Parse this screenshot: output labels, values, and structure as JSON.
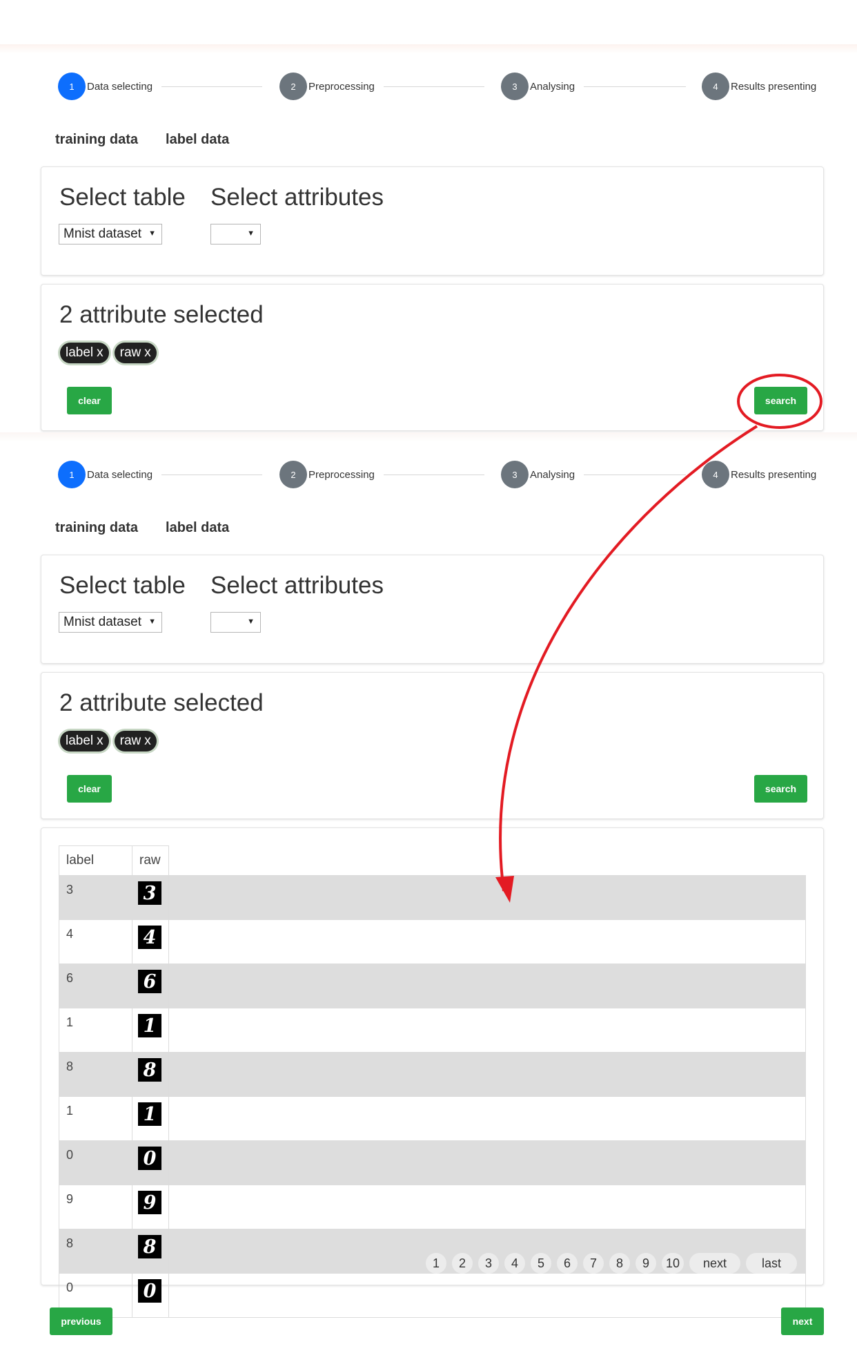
{
  "stepper": {
    "steps": [
      {
        "num": "1",
        "label": "Data selecting"
      },
      {
        "num": "2",
        "label": "Preprocessing"
      },
      {
        "num": "3",
        "label": "Analysing"
      },
      {
        "num": "4",
        "label": "Results presenting"
      }
    ]
  },
  "tabs": [
    "training data",
    "label data"
  ],
  "select_card": {
    "table_heading": "Select table",
    "attr_heading": "Select attributes",
    "table_value": "Mnist dataset",
    "attr_value": ""
  },
  "selected_card": {
    "heading": "2 attribute selected",
    "chips": [
      {
        "label": "label",
        "remove": "x"
      },
      {
        "label": "raw",
        "remove": "x"
      }
    ],
    "clear_label": "clear",
    "search_label": "search"
  },
  "results": {
    "columns": [
      "label",
      "raw"
    ],
    "rows": [
      {
        "label": "3",
        "raw": "3"
      },
      {
        "label": "4",
        "raw": "4"
      },
      {
        "label": "6",
        "raw": "6"
      },
      {
        "label": "1",
        "raw": "1"
      },
      {
        "label": "8",
        "raw": "8"
      },
      {
        "label": "1",
        "raw": "1"
      },
      {
        "label": "0",
        "raw": "0"
      },
      {
        "label": "9",
        "raw": "9"
      },
      {
        "label": "8",
        "raw": "8"
      },
      {
        "label": "0",
        "raw": "0"
      }
    ],
    "pages": [
      "1",
      "2",
      "3",
      "4",
      "5",
      "6",
      "7",
      "8",
      "9",
      "10"
    ],
    "next_label": "next",
    "last_label": "last"
  },
  "footer": {
    "previous_label": "previous",
    "next_label": "next"
  },
  "annotation_color": "#e31b23"
}
